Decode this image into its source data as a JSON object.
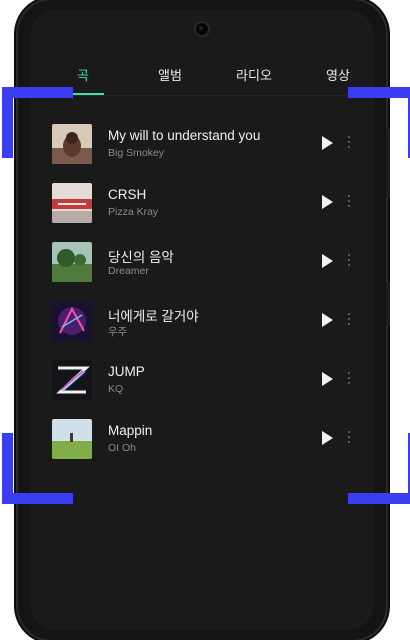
{
  "tabs": [
    {
      "label": "곡",
      "active": true
    },
    {
      "label": "앨범",
      "active": false
    },
    {
      "label": "라디오",
      "active": false
    },
    {
      "label": "영상",
      "active": false
    }
  ],
  "songs": [
    {
      "title": "My will to understand you",
      "artist": "Big Smokey"
    },
    {
      "title": "CRSH",
      "artist": "Pizza Kray"
    },
    {
      "title": "당신의 음악",
      "artist": "Dreamer"
    },
    {
      "title": "너에게로 갈거야",
      "artist": "우주"
    },
    {
      "title": "JUMP",
      "artist": "KQ"
    },
    {
      "title": "Mappin",
      "artist": "OI Oh"
    }
  ],
  "colors": {
    "accent": "#3fe0ad",
    "scan_frame": "#3b3ef0",
    "background": "#1a1a1b"
  },
  "icons": {
    "play": "play-icon",
    "more": "more-vertical-icon"
  }
}
